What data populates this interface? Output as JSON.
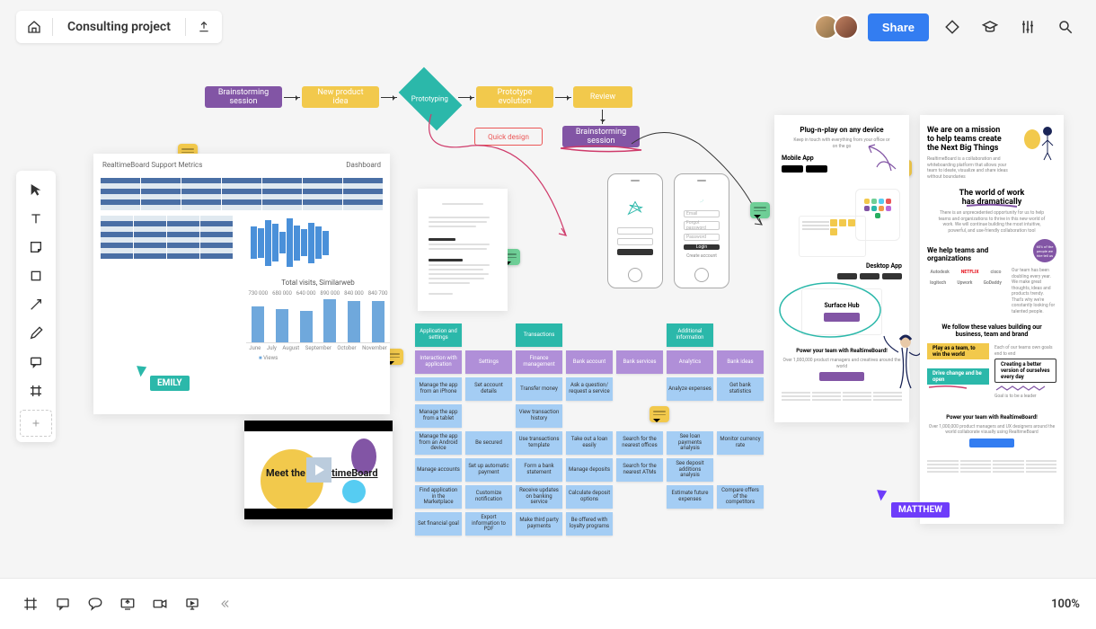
{
  "header": {
    "project_title": "Consulting project",
    "share_label": "Share"
  },
  "flow": {
    "n1": "Brainstorming session",
    "n2": "New product idea",
    "n3": "Prototyping",
    "n4": "Prototype evolution",
    "n5": "Review",
    "n6": "Quick design",
    "n7": "Brainstorming session"
  },
  "dashboard": {
    "title": "RealtimeBoard Support Metrics",
    "right_label": "Dashboard"
  },
  "chart_data": {
    "type": "bar",
    "title": "Total visits, Similarweb",
    "categories": [
      "June",
      "July",
      "August",
      "September",
      "October",
      "November"
    ],
    "values": [
      730000,
      680000,
      640000,
      890000,
      840000,
      840700
    ],
    "legend": "Views",
    "ylim": [
      0,
      900000
    ]
  },
  "video": {
    "title_pre": "Meet the ne",
    "title_post": "caltimeBoard"
  },
  "phones": {
    "left": {
      "scribble": "star"
    },
    "right": {
      "fields": [
        "Email",
        "Forgot password",
        "Password"
      ],
      "button": "Login",
      "link": "Create account"
    }
  },
  "stickies": {
    "rows": [
      [
        {
          "t": "Application and settings",
          "c": "teal"
        },
        {
          "t": "",
          "c": "empty"
        },
        {
          "t": "Transactions",
          "c": "teal"
        },
        {
          "t": "",
          "c": "empty"
        },
        {
          "t": "",
          "c": "empty"
        },
        {
          "t": "Additional information",
          "c": "teal"
        },
        {
          "t": "",
          "c": "empty"
        }
      ],
      [
        {
          "t": "Interaction with application",
          "c": "purple"
        },
        {
          "t": "Settings",
          "c": "purple"
        },
        {
          "t": "Finance management",
          "c": "purple"
        },
        {
          "t": "Bank account",
          "c": "purple"
        },
        {
          "t": "Bank services",
          "c": "purple"
        },
        {
          "t": "Analytics",
          "c": "purple"
        },
        {
          "t": "Bank ideas",
          "c": "purple"
        }
      ],
      [
        {
          "t": "Manage the app from an iPhone",
          "c": "blue"
        },
        {
          "t": "Set account details",
          "c": "blue"
        },
        {
          "t": "Transfer money",
          "c": "blue"
        },
        {
          "t": "Ask a question/ request a service",
          "c": "blue"
        },
        {
          "t": "",
          "c": "empty"
        },
        {
          "t": "Analyze expenses",
          "c": "blue"
        },
        {
          "t": "Get bank statistics",
          "c": "blue"
        }
      ],
      [
        {
          "t": "Manage the app from a tablet",
          "c": "blue"
        },
        {
          "t": "",
          "c": "empty"
        },
        {
          "t": "View transaction history",
          "c": "blue"
        },
        {
          "t": "",
          "c": "empty"
        },
        {
          "t": "",
          "c": "empty"
        },
        {
          "t": "",
          "c": "empty"
        },
        {
          "t": "",
          "c": "empty"
        }
      ],
      [
        {
          "t": "Manage the app from an Android device",
          "c": "blue"
        },
        {
          "t": "Be secured",
          "c": "blue"
        },
        {
          "t": "Use transactions template",
          "c": "blue"
        },
        {
          "t": "Take out a loan easily",
          "c": "blue"
        },
        {
          "t": "Search for the nearest offices",
          "c": "blue"
        },
        {
          "t": "See loan payments analysis",
          "c": "blue"
        },
        {
          "t": "Monitor currency rate",
          "c": "blue"
        }
      ],
      [
        {
          "t": "Manage accounts",
          "c": "blue"
        },
        {
          "t": "Set up automatic payment",
          "c": "blue"
        },
        {
          "t": "Form a bank statement",
          "c": "blue"
        },
        {
          "t": "Manage deposits",
          "c": "blue"
        },
        {
          "t": "Search for the nearest ATMs",
          "c": "blue"
        },
        {
          "t": "See deposit additions analysis",
          "c": "blue"
        },
        {
          "t": "",
          "c": "empty"
        }
      ],
      [
        {
          "t": "Find application in the Marketplace",
          "c": "blue"
        },
        {
          "t": "Customize notification",
          "c": "blue"
        },
        {
          "t": "Receive updates on banking service",
          "c": "blue"
        },
        {
          "t": "Calculate deposit options",
          "c": "blue"
        },
        {
          "t": "",
          "c": "empty"
        },
        {
          "t": "Estimate future expenses",
          "c": "blue"
        },
        {
          "t": "Compare offers of the competitors",
          "c": "blue"
        }
      ],
      [
        {
          "t": "Set financial goal",
          "c": "blue"
        },
        {
          "t": "Export information to PDF",
          "c": "blue"
        },
        {
          "t": "Make third party payments",
          "c": "blue"
        },
        {
          "t": "Be offered with loyalty programs",
          "c": "blue"
        },
        {
          "t": "",
          "c": "empty"
        },
        {
          "t": "",
          "c": "empty"
        },
        {
          "t": "",
          "c": "empty"
        }
      ]
    ]
  },
  "web_left": {
    "h1": "Plug-n-play on any device",
    "sections": {
      "mobile": "Mobile App",
      "desktop": "Desktop App",
      "surface": "Surface Hub"
    },
    "cta": "Power your team with RealtimeBoard!"
  },
  "web_right": {
    "h1": "We are on a mission to help teams create the Next Big Things",
    "h2": "The world of work has dramatically",
    "h3": "We help teams and organizations",
    "h4": "We follow these values building our business, team and brand",
    "tag1": "Play as a team, to win the world",
    "tag2": "Drive change and be open",
    "tag3": "Creating a better version of ourselves every day",
    "badge": "60% of the people we hire tell us",
    "footer_cta": "Power your team with RealtimeBoard!",
    "logos": [
      "Autodesk",
      "NETFLIX",
      "cisco",
      "logitech",
      "Upwork",
      "GoDaddy"
    ]
  },
  "cursors": {
    "emily": "EMILY",
    "matthew": "MATTHEW"
  },
  "zoom": "100%"
}
